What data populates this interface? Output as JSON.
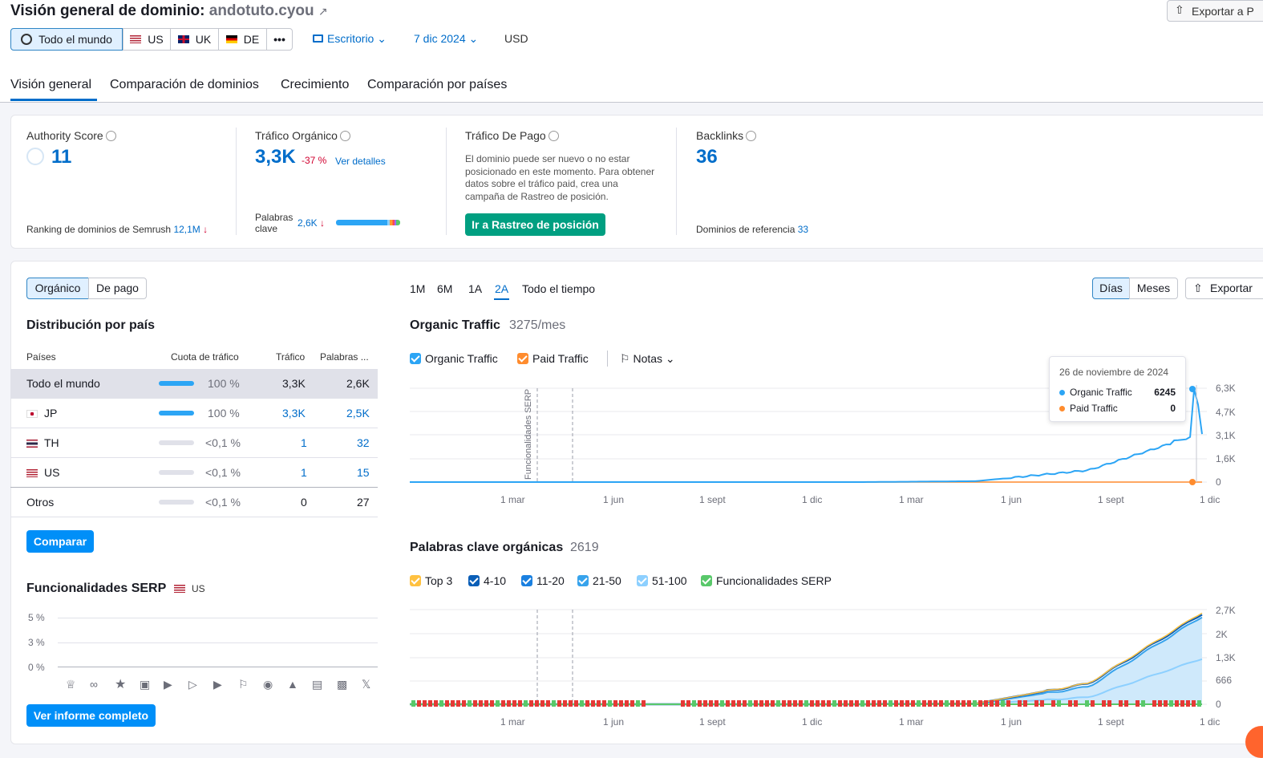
{
  "header": {
    "title_prefix": "Visión general de dominio:",
    "domain": "andotuto.cyou",
    "export_label": "Exportar a P",
    "regions": [
      {
        "label": "Todo el mundo"
      },
      {
        "label": "US"
      },
      {
        "label": "UK"
      },
      {
        "label": "DE"
      },
      {
        "label": "•••"
      }
    ],
    "device": "Escritorio",
    "date": "7 dic 2024",
    "currency": "USD"
  },
  "tabs": [
    "Visión general",
    "Comparación de dominios",
    "Crecimiento",
    "Comparación por países"
  ],
  "summary": {
    "authority": {
      "label": "Authority Score",
      "value": "11",
      "footer_label": "Ranking de dominios de Semrush",
      "footer_value": "12,1M"
    },
    "organic": {
      "label": "Tráfico Orgánico",
      "value": "3,3K",
      "change": "-37 %",
      "link": "Ver detalles",
      "kw_label_1": "Palabras",
      "kw_label_2": "clave",
      "kw_value": "2,6K"
    },
    "paid": {
      "label": "Tráfico De Pago",
      "text": "El dominio puede ser nuevo o no estar posicionado en este momento. Para obtener datos sobre el tráfico paid, crea una campaña de Rastreo de posición.",
      "button": "Ir a Rastreo de posición"
    },
    "backlinks": {
      "label": "Backlinks",
      "value": "36",
      "footer_label": "Dominios de referencia",
      "footer_value": "33"
    }
  },
  "left": {
    "toggle": [
      "Orgánico",
      "De pago"
    ],
    "dist_title": "Distribución por país",
    "columns": [
      "Países",
      "Cuota de tráfico",
      "Tráfico",
      "Palabras ..."
    ],
    "rows": [
      {
        "country": "Todo el mundo",
        "share": "100 %",
        "traffic": "3,3K",
        "keywords": "2,6K"
      },
      {
        "country": "JP",
        "share": "100 %",
        "traffic": "3,3K",
        "keywords": "2,5K"
      },
      {
        "country": "TH",
        "share": "<0,1 %",
        "traffic": "1",
        "keywords": "32"
      },
      {
        "country": "US",
        "share": "<0,1 %",
        "traffic": "1",
        "keywords": "15"
      },
      {
        "country": "Otros",
        "share": "<0,1 %",
        "traffic": "0",
        "keywords": "27"
      }
    ],
    "compare_button": "Comparar",
    "serp_title": "Funcionalidades SERP",
    "serp_region": "US",
    "serp_ticks": [
      "5 %",
      "3 %",
      "0 %"
    ],
    "report_button": "Ver informe completo"
  },
  "right": {
    "periods": [
      "1M",
      "6M",
      "1A",
      "2A",
      "Todo el tiempo"
    ],
    "gran": [
      "Días",
      "Meses"
    ],
    "export_label": "Exportar",
    "traffic_title": "Organic Traffic",
    "traffic_value": "3275/mes",
    "legend_organic": "Organic Traffic",
    "legend_paid": "Paid Traffic",
    "notes": "Notas",
    "serp_marker": "Funcionalidades SERP",
    "x_ticks": [
      "1 mar",
      "1 jun",
      "1 sept",
      "1 dic",
      "1 mar",
      "1 jun",
      "1 sept",
      "1 dic"
    ],
    "traffic_y": [
      "6,3K",
      "4,7K",
      "3,1K",
      "1,6K",
      "0"
    ],
    "tooltip": {
      "date": "26 de noviembre de 2024",
      "organic_label": "Organic Traffic",
      "organic_value": "6245",
      "paid_label": "Paid Traffic",
      "paid_value": "0"
    },
    "kw_title": "Palabras clave orgánicas",
    "kw_value": "2619",
    "kw_legend": [
      "Top 3",
      "4-10",
      "11-20",
      "21-50",
      "51-100",
      "Funcionalidades SERP"
    ],
    "kw_y": [
      "2,7K",
      "2K",
      "1,3K",
      "666",
      "0"
    ]
  },
  "colors": {
    "accent": "#006dca",
    "organic": "#2ca5f5",
    "paid": "#ff8c2e",
    "green_button": "#009f81",
    "negative": "#d1002f"
  },
  "chart_data": [
    {
      "type": "line",
      "title": "Organic Traffic",
      "x": [
        "1 mar",
        "1 jun",
        "1 sept",
        "1 dic",
        "1 mar",
        "1 jun",
        "1 sept",
        "1 dic"
      ],
      "series": [
        {
          "name": "Organic Traffic",
          "values": [
            0,
            0,
            0,
            0,
            0,
            60,
            800,
            3275
          ]
        },
        {
          "name": "Paid Traffic",
          "values": [
            0,
            0,
            0,
            0,
            0,
            0,
            0,
            0
          ]
        }
      ],
      "ylim": [
        0,
        6300
      ]
    },
    {
      "type": "area",
      "title": "Palabras clave orgánicas",
      "x": [
        "1 mar",
        "1 jun",
        "1 sept",
        "1 dic",
        "1 mar",
        "1 jun",
        "1 sept",
        "1 dic"
      ],
      "series": [
        {
          "name": "Top 3",
          "values": [
            0,
            0,
            0,
            0,
            0,
            20,
            600,
            2619
          ]
        },
        {
          "name": "4-10",
          "values": [
            0,
            0,
            0,
            0,
            0,
            15,
            500,
            2500
          ]
        },
        {
          "name": "51-100",
          "values": [
            0,
            0,
            0,
            0,
            0,
            5,
            200,
            1300
          ]
        }
      ],
      "ylim": [
        0,
        2700
      ]
    }
  ]
}
